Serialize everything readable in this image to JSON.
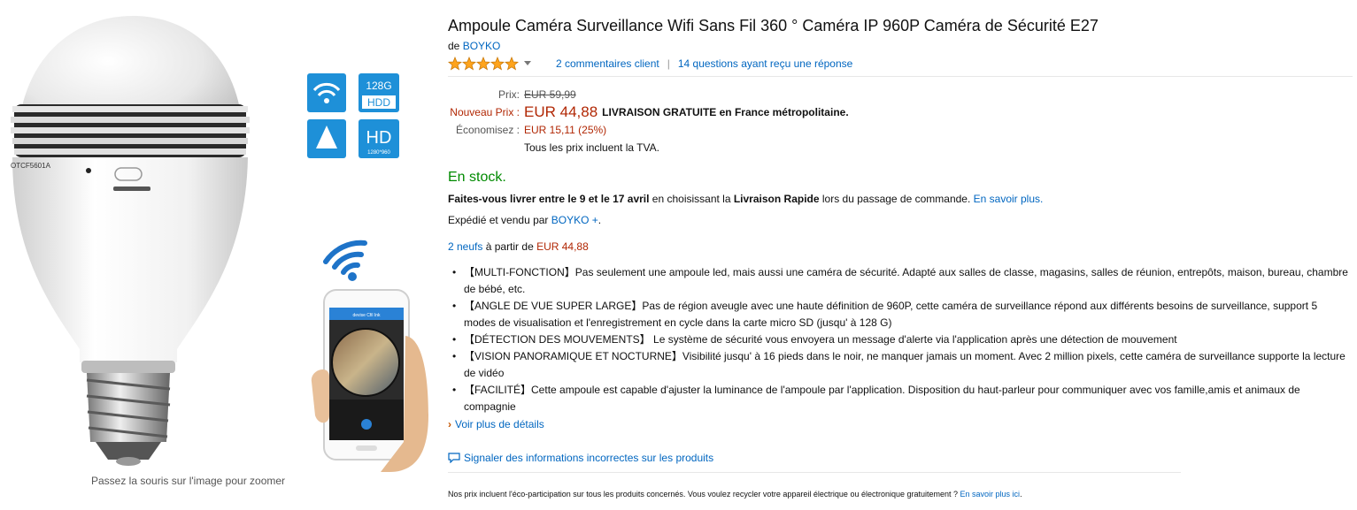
{
  "image": {
    "zoom_hint": "Passez la souris sur l'image pour zoomer",
    "badges": {
      "storage_top": "128G",
      "storage_bottom": "HDD",
      "hd_big": "HD",
      "hd_small": "1280*960",
      "angle": "360°"
    },
    "bulb_label": "OTCF5601A",
    "phone_header": "devise Cfil Ink"
  },
  "product": {
    "title": "Ampoule Caméra Surveillance Wifi Sans Fil 360 ° Caméra IP 960P Caméra de Sécurité E27",
    "by_prefix": "de",
    "brand": "BOYKO",
    "rating_stars": 5,
    "reviews_link": "2 commentaires client",
    "rating_sep": "|",
    "questions_link": "14 questions ayant reçu une réponse"
  },
  "pricing": {
    "price_label": "Prix:",
    "old_price": "EUR 59,99",
    "new_label": "Nouveau Prix :",
    "new_price": "EUR 44,88",
    "free_shipping": "LIVRAISON GRATUITE en France métropolitaine.",
    "savings_label": "Économisez :",
    "savings": "EUR 15,11 (25%)",
    "vat_note": "Tous les prix incluent la TVA."
  },
  "availability": {
    "stock": "En stock.",
    "delivery_bold": "Faites-vous livrer entre le 9 et le 17 avril",
    "delivery_mid": " en choisissant la ",
    "delivery_bold2": "Livraison Rapide",
    "delivery_end": " lors du passage de commande. ",
    "learn_more": "En savoir plus.",
    "shipped_prefix": "Expédié et vendu par ",
    "seller": "BOYKO +",
    "shipped_suffix": ".",
    "offers_link": "2 neufs",
    "offers_mid": " à partir de ",
    "offers_price": "EUR 44,88"
  },
  "bullets": [
    "【MULTI-FONCTION】Pas seulement une ampoule led, mais aussi une caméra de sécurité. Adapté aux salles de classe, magasins, salles de réunion, entrepôts, maison, bureau, chambre de bébé, etc.",
    "【ANGLE DE VUE SUPER LARGE】Pas de région aveugle avec une haute définition de 960P, cette caméra de surveillance répond aux différents besoins de surveillance, support 5 modes de visualisation et l'enregistrement en cycle dans la carte micro SD (jusqu' à 128 G)",
    "【DÉTECTION DES MOUVEMENTS】 Le système de sécurité vous envoyera un message d'alerte via l'application après une détection de mouvement",
    "【VISION PANORAMIQUE ET NOCTURNE】Visibilité jusqu' à 16 pieds dans le noir, ne manquer jamais un moment. Avec 2 million pixels, cette caméra de surveillance supporte la lecture de vidéo",
    "【FACILITÉ】Cette ampoule est capable d'ajuster la luminance de l'ampoule par l'application. Disposition du haut-parleur pour communiquer avec vos famille,amis et animaux de compagnie"
  ],
  "see_more": {
    "chevron": "›",
    "label": "Voir plus de détails"
  },
  "report_link": "Signaler des informations incorrectes sur les produits",
  "footnote": {
    "text": "Nos prix incluent l'éco-participation sur tous les produits concernés. Vous voulez recycler votre appareil électrique ou électronique gratuitement ? ",
    "link": "En savoir plus ici",
    "end": "."
  },
  "colors": {
    "link": "#0066c0",
    "price": "#b12704",
    "stock": "#008a00",
    "star": "#ffa41c",
    "badge": "#1e90d8"
  }
}
